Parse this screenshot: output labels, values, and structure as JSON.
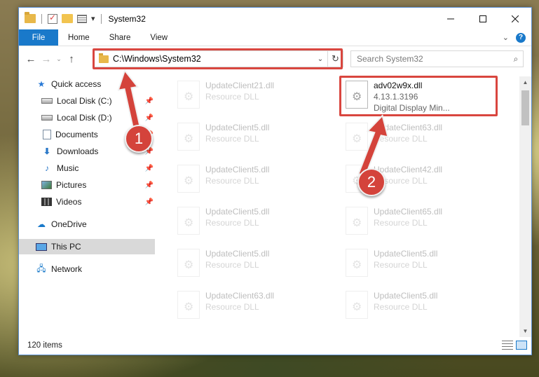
{
  "window": {
    "title": "System32",
    "qat_menu_glyph": "▾"
  },
  "ribbon": {
    "file_tab": "File",
    "tabs": [
      "Home",
      "Share",
      "View"
    ],
    "help_glyph": "?"
  },
  "address": {
    "path": "C:\\Windows\\System32",
    "search_placeholder": "Search System32"
  },
  "nav_pane": {
    "items": [
      {
        "label": "Quick access",
        "icon": "star-icon",
        "pinned": false
      },
      {
        "label": "Local Disk (C:)",
        "icon": "drive-icon",
        "pinned": true
      },
      {
        "label": "Local Disk (D:)",
        "icon": "drive-icon",
        "pinned": true
      },
      {
        "label": "Documents",
        "icon": "documents-icon",
        "pinned": true
      },
      {
        "label": "Downloads",
        "icon": "download-icon",
        "pinned": true
      },
      {
        "label": "Music",
        "icon": "music-icon",
        "pinned": true
      },
      {
        "label": "Pictures",
        "icon": "pictures-icon",
        "pinned": true
      },
      {
        "label": "Videos",
        "icon": "videos-icon",
        "pinned": true
      },
      {
        "label": "OneDrive",
        "icon": "cloud-icon",
        "pinned": false
      },
      {
        "label": "This PC",
        "icon": "pc-icon",
        "pinned": false,
        "selected": true
      },
      {
        "label": "Network",
        "icon": "network-icon",
        "pinned": false
      }
    ]
  },
  "files": {
    "featured": {
      "name": "adv02w9x.dll",
      "version": "4.13.1.3196",
      "description": "Digital Display Min..."
    },
    "left_column": [
      {
        "name": "UpdateClient21.dll",
        "type": "Resource DLL"
      },
      {
        "name": "UpdateClient5.dll",
        "type": "Resource DLL"
      },
      {
        "name": "UpdateClient5.dll",
        "type": "Resource DLL"
      },
      {
        "name": "UpdateClient5.dll",
        "type": "Resource DLL"
      },
      {
        "name": "UpdateClient5.dll",
        "type": "Resource DLL"
      },
      {
        "name": "UpdateClient63.dll",
        "type": "Resource DLL"
      }
    ],
    "right_column": [
      {
        "name": "UpdateClient63.dll",
        "type": "Resource DLL"
      },
      {
        "name": "UpdateClient42.dll",
        "type": "Resource DLL"
      },
      {
        "name": "UpdateClient65.dll",
        "type": "Resource DLL"
      },
      {
        "name": "UpdateClient5.dll",
        "type": "Resource DLL"
      },
      {
        "name": "UpdateClient5.dll",
        "type": "Resource DLL"
      }
    ]
  },
  "status": {
    "item_count": "120 items"
  },
  "annotations": {
    "step1": "1",
    "step2": "2",
    "highlight_color": "#d9463f"
  }
}
